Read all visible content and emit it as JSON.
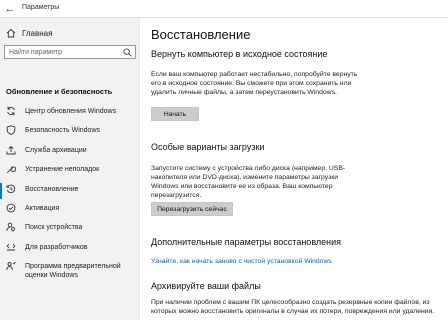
{
  "window": {
    "title": "Параметры"
  },
  "sidebar": {
    "home_label": "Главная",
    "search_placeholder": "Найти параметр",
    "section_title": "Обновление и безопасность",
    "items": [
      {
        "label": "Центр обновления Windows",
        "icon": "sync-icon"
      },
      {
        "label": "Безопасность Windows",
        "icon": "shield-icon"
      },
      {
        "label": "Служба архивации",
        "icon": "upload-icon"
      },
      {
        "label": "Устранение неполадок",
        "icon": "wrench-icon"
      },
      {
        "label": "Восстановление",
        "icon": "history-icon",
        "active": true
      },
      {
        "label": "Активация",
        "icon": "check-circle-icon"
      },
      {
        "label": "Поиск устройства",
        "icon": "person-locate-icon"
      },
      {
        "label": "Для разработчиков",
        "icon": "developer-icon"
      },
      {
        "label": "Программа предварительной оценки Windows",
        "icon": "insider-icon"
      }
    ]
  },
  "main": {
    "title": "Восстановление",
    "reset": {
      "heading": "Вернуть компьютер в исходное состояние",
      "text": "Если ваш компьютер работает нестабильно, попробуйте вернуть его в исходное состояние. Вы сможете при этом сохранить или удалить личные файлы, а затем переустановить Windows.",
      "button": "Начать"
    },
    "advanced_startup": {
      "heading": "Особые варианты загрузки",
      "text": "Запустите систему с устройства либо диска (например, USB-накопителя или DVD-диска), измените параметры загрузки Windows или восстановите ее из образа. Ваш компьютер перезагрузится.",
      "button": "Перезагрузить сейчас"
    },
    "more_options": {
      "heading": "Дополнительные параметры восстановления",
      "link": "Узнайте, как начать заново с чистой установкой Windows"
    },
    "backup": {
      "heading": "Архивируйте ваши файлы",
      "text": "При наличии проблем с вашим ПК целесообразно создать резервные копии файлов, из которых можно восстановить оригиналы в случае их потери, повреждения или удаления."
    }
  },
  "colors": {
    "accent": "#0078d7",
    "link": "#0066b4",
    "sidebar_bg": "#f2f2f2",
    "button_bg": "#cccccc"
  }
}
